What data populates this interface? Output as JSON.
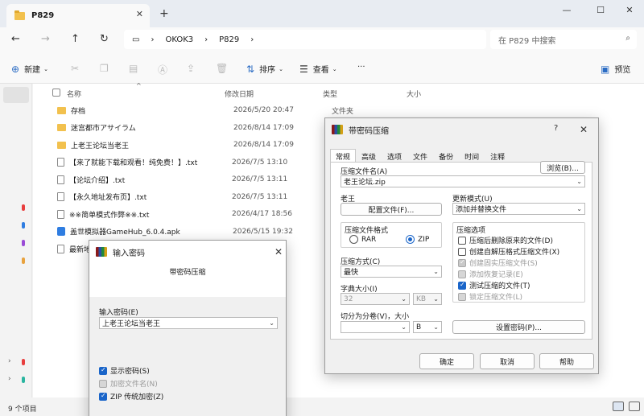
{
  "explorer": {
    "tab_title": "P829",
    "breadcrumb": [
      "OKOK3",
      "P829"
    ],
    "search_placeholder": "在 P829 中搜索",
    "toolbar": {
      "new": "新建",
      "sort": "排序",
      "view": "查看",
      "preview": "预览"
    },
    "columns": {
      "name": "名称",
      "date": "修改日期",
      "type": "类型",
      "size": "大小"
    },
    "files": [
      {
        "name": "存档",
        "date": "2026/5/20 20:47",
        "type": "文件夹",
        "kind": "folder"
      },
      {
        "name": "迷宫都市アサイラム",
        "date": "2026/8/14 17:09",
        "type": "",
        "kind": "folder"
      },
      {
        "name": "上老王论坛当老王",
        "date": "2026/8/14 17:09",
        "type": "",
        "kind": "folder"
      },
      {
        "name": "【来了就能下载和观看！纯免费！】.txt",
        "date": "2026/7/5 13:10",
        "type": "",
        "kind": "txt"
      },
      {
        "name": "【论坛介绍】.txt",
        "date": "2026/7/5 13:11",
        "type": "",
        "kind": "txt"
      },
      {
        "name": "【永久地址发布页】.txt",
        "date": "2026/7/5 13:11",
        "type": "",
        "kind": "txt"
      },
      {
        "name": "※※简单模式作弊※※.txt",
        "date": "2026/4/17 18:56",
        "type": "",
        "kind": "txt"
      },
      {
        "name": "盖世模拟器GameHub_6.0.4.apk",
        "date": "2026/5/15 19:32",
        "type": "",
        "kind": "apk"
      },
      {
        "name": "最新地",
        "date": "",
        "type": "",
        "kind": "txt"
      }
    ],
    "status": "9 个项目"
  },
  "archive_dialog": {
    "title": "带密码压缩",
    "help_symbol": "?",
    "tabs": [
      "常规",
      "高级",
      "选项",
      "文件",
      "备份",
      "时间",
      "注释"
    ],
    "archive_name_label": "压缩文件名(A)",
    "browse": "浏览(B)...",
    "archive_name": "老王论坛.zip",
    "profiles_label": "老王",
    "profiles_button": "配置文件(F)...",
    "update_mode_label": "更新模式(U)",
    "update_mode": "添加并替换文件",
    "format_label": "压缩文件格式",
    "format_rar": "RAR",
    "format_zip": "ZIP",
    "method_label": "压缩方式(C)",
    "method": "最快",
    "dict_label": "字典大小(I)",
    "dict_value": "32",
    "dict_unit": "KB",
    "split_label": "切分为分卷(V)，大小",
    "split_unit": "B",
    "options_label": "压缩选项",
    "options": [
      {
        "label": "压缩后删除原来的文件(D)",
        "checked": false,
        "disabled": false
      },
      {
        "label": "创建自解压格式压缩文件(X)",
        "checked": false,
        "disabled": false
      },
      {
        "label": "创建固实压缩文件(S)",
        "checked": true,
        "disabled": true
      },
      {
        "label": "添加恢复记录(E)",
        "checked": false,
        "disabled": true
      },
      {
        "label": "测试压缩的文件(T)",
        "checked": true,
        "disabled": false
      },
      {
        "label": "锁定压缩文件(L)",
        "checked": false,
        "disabled": true
      }
    ],
    "set_password": "设置密码(P)...",
    "ok": "确定",
    "cancel": "取消",
    "help": "帮助"
  },
  "password_dialog": {
    "title": "输入密码",
    "subtitle": "带密码压缩",
    "enter_label": "输入密码(E)",
    "password": "上老王论坛当老王",
    "show_password": "显示密码(S)",
    "encrypt_names": "加密文件名(N)",
    "zip_legacy": "ZIP 传统加密(Z)"
  }
}
